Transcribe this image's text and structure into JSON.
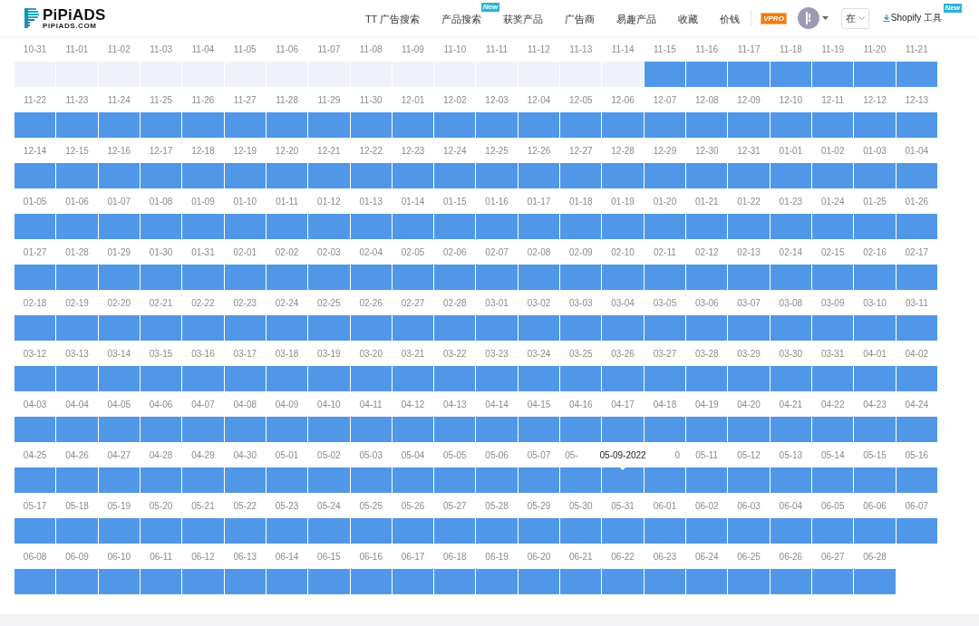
{
  "header": {
    "logo": {
      "name": "PiPiADS",
      "domain": "PIPIADS.COM"
    },
    "nav": [
      {
        "label": "TT 广告搜索"
      },
      {
        "label": "产品搜索",
        "badge": "New"
      },
      {
        "label": "获奖产品"
      },
      {
        "label": "广告商"
      },
      {
        "label": "易趣产品"
      },
      {
        "label": "收藏"
      },
      {
        "label": "价钱"
      }
    ],
    "pro_badge": "VPRO",
    "language": "在",
    "shopify": {
      "label": "Shopify 工具",
      "badge": "New"
    }
  },
  "days": [
    {
      "label": "10-31",
      "active": false
    },
    {
      "label": "11-01",
      "active": false
    },
    {
      "label": "11-02",
      "active": false
    },
    {
      "label": "11-03",
      "active": false
    },
    {
      "label": "11-04",
      "active": false
    },
    {
      "label": "11-05",
      "active": false
    },
    {
      "label": "11-06",
      "active": false
    },
    {
      "label": "11-07",
      "active": false
    },
    {
      "label": "11-08",
      "active": false
    },
    {
      "label": "11-09",
      "active": false
    },
    {
      "label": "11-10",
      "active": false
    },
    {
      "label": "11-11",
      "active": false
    },
    {
      "label": "11-12",
      "active": false
    },
    {
      "label": "11-13",
      "active": false
    },
    {
      "label": "11-14",
      "active": false
    },
    {
      "label": "11-15",
      "active": true
    },
    {
      "label": "11-16",
      "active": true
    },
    {
      "label": "11-17",
      "active": true
    },
    {
      "label": "11-18",
      "active": true
    },
    {
      "label": "11-19",
      "active": true
    },
    {
      "label": "11-20",
      "active": true
    },
    {
      "label": "11-21",
      "active": true
    },
    {
      "label": "11-22",
      "active": true
    },
    {
      "label": "11-23",
      "active": true
    },
    {
      "label": "11-24",
      "active": true
    },
    {
      "label": "11-25",
      "active": true
    },
    {
      "label": "11-26",
      "active": true
    },
    {
      "label": "11-27",
      "active": true
    },
    {
      "label": "11-28",
      "active": true
    },
    {
      "label": "11-29",
      "active": true
    },
    {
      "label": "11-30",
      "active": true
    },
    {
      "label": "12-01",
      "active": true
    },
    {
      "label": "12-02",
      "active": true
    },
    {
      "label": "12-03",
      "active": true
    },
    {
      "label": "12-04",
      "active": true
    },
    {
      "label": "12-05",
      "active": true
    },
    {
      "label": "12-06",
      "active": true
    },
    {
      "label": "12-07",
      "active": true
    },
    {
      "label": "12-08",
      "active": true
    },
    {
      "label": "12-09",
      "active": true
    },
    {
      "label": "12-10",
      "active": true
    },
    {
      "label": "12-11",
      "active": true
    },
    {
      "label": "12-12",
      "active": true
    },
    {
      "label": "12-13",
      "active": true
    },
    {
      "label": "12-14",
      "active": true
    },
    {
      "label": "12-15",
      "active": true
    },
    {
      "label": "12-16",
      "active": true
    },
    {
      "label": "12-17",
      "active": true
    },
    {
      "label": "12-18",
      "active": true
    },
    {
      "label": "12-19",
      "active": true
    },
    {
      "label": "12-20",
      "active": true
    },
    {
      "label": "12-21",
      "active": true
    },
    {
      "label": "12-22",
      "active": true
    },
    {
      "label": "12-23",
      "active": true
    },
    {
      "label": "12-24",
      "active": true
    },
    {
      "label": "12-25",
      "active": true
    },
    {
      "label": "12-26",
      "active": true
    },
    {
      "label": "12-27",
      "active": true
    },
    {
      "label": "12-28",
      "active": true
    },
    {
      "label": "12-29",
      "active": true
    },
    {
      "label": "12-30",
      "active": true
    },
    {
      "label": "12-31",
      "active": true
    },
    {
      "label": "01-01",
      "active": true
    },
    {
      "label": "01-02",
      "active": true
    },
    {
      "label": "01-03",
      "active": true
    },
    {
      "label": "01-04",
      "active": true
    },
    {
      "label": "01-05",
      "active": true
    },
    {
      "label": "01-06",
      "active": true
    },
    {
      "label": "01-07",
      "active": true
    },
    {
      "label": "01-08",
      "active": true
    },
    {
      "label": "01-09",
      "active": true
    },
    {
      "label": "01-10",
      "active": true
    },
    {
      "label": "01-11",
      "active": true
    },
    {
      "label": "01-12",
      "active": true
    },
    {
      "label": "01-13",
      "active": true
    },
    {
      "label": "01-14",
      "active": true
    },
    {
      "label": "01-15",
      "active": true
    },
    {
      "label": "01-16",
      "active": true
    },
    {
      "label": "01-17",
      "active": true
    },
    {
      "label": "01-18",
      "active": true
    },
    {
      "label": "01-19",
      "active": true
    },
    {
      "label": "01-20",
      "active": true
    },
    {
      "label": "01-21",
      "active": true
    },
    {
      "label": "01-22",
      "active": true
    },
    {
      "label": "01-23",
      "active": true
    },
    {
      "label": "01-24",
      "active": true
    },
    {
      "label": "01-25",
      "active": true
    },
    {
      "label": "01-26",
      "active": true
    },
    {
      "label": "01-27",
      "active": true
    },
    {
      "label": "01-28",
      "active": true
    },
    {
      "label": "01-29",
      "active": true
    },
    {
      "label": "01-30",
      "active": true
    },
    {
      "label": "01-31",
      "active": true
    },
    {
      "label": "02-01",
      "active": true
    },
    {
      "label": "02-02",
      "active": true
    },
    {
      "label": "02-03",
      "active": true
    },
    {
      "label": "02-04",
      "active": true
    },
    {
      "label": "02-05",
      "active": true
    },
    {
      "label": "02-06",
      "active": true
    },
    {
      "label": "02-07",
      "active": true
    },
    {
      "label": "02-08",
      "active": true
    },
    {
      "label": "02-09",
      "active": true
    },
    {
      "label": "02-10",
      "active": true
    },
    {
      "label": "02-11",
      "active": true
    },
    {
      "label": "02-12",
      "active": true
    },
    {
      "label": "02-13",
      "active": true
    },
    {
      "label": "02-14",
      "active": true
    },
    {
      "label": "02-15",
      "active": true
    },
    {
      "label": "02-16",
      "active": true
    },
    {
      "label": "02-17",
      "active": true
    },
    {
      "label": "02-18",
      "active": true
    },
    {
      "label": "02-19",
      "active": true
    },
    {
      "label": "02-20",
      "active": true
    },
    {
      "label": "02-21",
      "active": true
    },
    {
      "label": "02-22",
      "active": true
    },
    {
      "label": "02-23",
      "active": true
    },
    {
      "label": "02-24",
      "active": true
    },
    {
      "label": "02-25",
      "active": true
    },
    {
      "label": "02-26",
      "active": true
    },
    {
      "label": "02-27",
      "active": true
    },
    {
      "label": "02-28",
      "active": true
    },
    {
      "label": "03-01",
      "active": true
    },
    {
      "label": "03-02",
      "active": true
    },
    {
      "label": "03-03",
      "active": true
    },
    {
      "label": "03-04",
      "active": true
    },
    {
      "label": "03-05",
      "active": true
    },
    {
      "label": "03-06",
      "active": true
    },
    {
      "label": "03-07",
      "active": true
    },
    {
      "label": "03-08",
      "active": true
    },
    {
      "label": "03-09",
      "active": true
    },
    {
      "label": "03-10",
      "active": true
    },
    {
      "label": "03-11",
      "active": true
    },
    {
      "label": "03-12",
      "active": true
    },
    {
      "label": "03-13",
      "active": true
    },
    {
      "label": "03-14",
      "active": true
    },
    {
      "label": "03-15",
      "active": true
    },
    {
      "label": "03-16",
      "active": true
    },
    {
      "label": "03-17",
      "active": true
    },
    {
      "label": "03-18",
      "active": true
    },
    {
      "label": "03-19",
      "active": true
    },
    {
      "label": "03-20",
      "active": true
    },
    {
      "label": "03-21",
      "active": true
    },
    {
      "label": "03-22",
      "active": true
    },
    {
      "label": "03-23",
      "active": true
    },
    {
      "label": "03-24",
      "active": true
    },
    {
      "label": "03-25",
      "active": true
    },
    {
      "label": "03-26",
      "active": true
    },
    {
      "label": "03-27",
      "active": true
    },
    {
      "label": "03-28",
      "active": true
    },
    {
      "label": "03-29",
      "active": true
    },
    {
      "label": "03-30",
      "active": true
    },
    {
      "label": "03-31",
      "active": true
    },
    {
      "label": "04-01",
      "active": true
    },
    {
      "label": "04-02",
      "active": true
    },
    {
      "label": "04-03",
      "active": true
    },
    {
      "label": "04-04",
      "active": true
    },
    {
      "label": "04-05",
      "active": true
    },
    {
      "label": "04-06",
      "active": true
    },
    {
      "label": "04-07",
      "active": true
    },
    {
      "label": "04-08",
      "active": true
    },
    {
      "label": "04-09",
      "active": true
    },
    {
      "label": "04-10",
      "active": true
    },
    {
      "label": "04-11",
      "active": true
    },
    {
      "label": "04-12",
      "active": true
    },
    {
      "label": "04-13",
      "active": true
    },
    {
      "label": "04-14",
      "active": true
    },
    {
      "label": "04-15",
      "active": true
    },
    {
      "label": "04-16",
      "active": true
    },
    {
      "label": "04-17",
      "active": true
    },
    {
      "label": "04-18",
      "active": true
    },
    {
      "label": "04-19",
      "active": true
    },
    {
      "label": "04-20",
      "active": true
    },
    {
      "label": "04-21",
      "active": true
    },
    {
      "label": "04-22",
      "active": true
    },
    {
      "label": "04-23",
      "active": true
    },
    {
      "label": "04-24",
      "active": true
    },
    {
      "label": "04-25",
      "active": true
    },
    {
      "label": "04-26",
      "active": true
    },
    {
      "label": "04-27",
      "active": true
    },
    {
      "label": "04-28",
      "active": true
    },
    {
      "label": "04-29",
      "active": true
    },
    {
      "label": "04-30",
      "active": true
    },
    {
      "label": "05-01",
      "active": true
    },
    {
      "label": "05-02",
      "active": true
    },
    {
      "label": "05-03",
      "active": true
    },
    {
      "label": "05-04",
      "active": true
    },
    {
      "label": "05-05",
      "active": true
    },
    {
      "label": "05-06",
      "active": true
    },
    {
      "label": "05-07",
      "active": true
    },
    {
      "label": "05-",
      "kind": "head",
      "active": true
    },
    {
      "tooltip": "05-09-2022",
      "active": true
    },
    {
      "label": "0",
      "kind": "tail",
      "active": true
    },
    {
      "label": "05-11",
      "active": true
    },
    {
      "label": "05-12",
      "active": true
    },
    {
      "label": "05-13",
      "active": true
    },
    {
      "label": "05-14",
      "active": true
    },
    {
      "label": "05-15",
      "active": true
    },
    {
      "label": "05-16",
      "active": true
    },
    {
      "label": "05-17",
      "active": true
    },
    {
      "label": "05-18",
      "active": true
    },
    {
      "label": "05-19",
      "active": true
    },
    {
      "label": "05-20",
      "active": true
    },
    {
      "label": "05-21",
      "active": true
    },
    {
      "label": "05-22",
      "active": true
    },
    {
      "label": "05-23",
      "active": true
    },
    {
      "label": "05-24",
      "active": true
    },
    {
      "label": "05-25",
      "active": true
    },
    {
      "label": "05-26",
      "active": true
    },
    {
      "label": "05-27",
      "active": true
    },
    {
      "label": "05-28",
      "active": true
    },
    {
      "label": "05-29",
      "active": true
    },
    {
      "label": "05-30",
      "active": true
    },
    {
      "label": "05-31",
      "active": true
    },
    {
      "label": "06-01",
      "active": true
    },
    {
      "label": "06-02",
      "active": true
    },
    {
      "label": "06-03",
      "active": true
    },
    {
      "label": "06-04",
      "active": true
    },
    {
      "label": "06-05",
      "active": true
    },
    {
      "label": "06-06",
      "active": true
    },
    {
      "label": "06-07",
      "active": true
    },
    {
      "label": "06-08",
      "active": true
    },
    {
      "label": "06-09",
      "active": true
    },
    {
      "label": "06-10",
      "active": true
    },
    {
      "label": "06-11",
      "active": true
    },
    {
      "label": "06-12",
      "active": true
    },
    {
      "label": "06-13",
      "active": true
    },
    {
      "label": "06-14",
      "active": true
    },
    {
      "label": "06-15",
      "active": true
    },
    {
      "label": "06-16",
      "active": true
    },
    {
      "label": "06-17",
      "active": true
    },
    {
      "label": "06-18",
      "active": true
    },
    {
      "label": "06-19",
      "active": true
    },
    {
      "label": "06-20",
      "active": true
    },
    {
      "label": "06-21",
      "active": true
    },
    {
      "label": "06-22",
      "active": true
    },
    {
      "label": "06-23",
      "active": true
    },
    {
      "label": "06-24",
      "active": true
    },
    {
      "label": "06-25",
      "active": true
    },
    {
      "label": "06-26",
      "active": true
    },
    {
      "label": "06-27",
      "active": true
    },
    {
      "label": "06-28",
      "active": true
    }
  ]
}
